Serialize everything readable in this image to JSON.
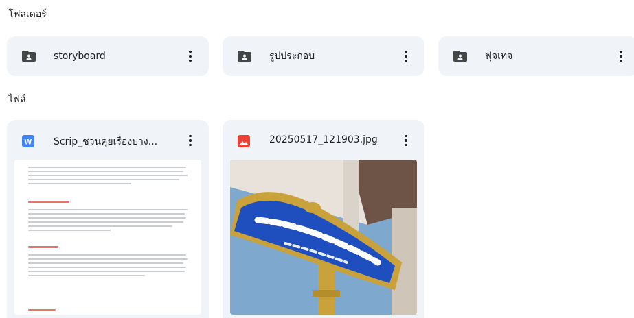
{
  "sections": {
    "folders_title": "โฟลเดอร์",
    "files_title": "ไฟล์"
  },
  "folders": [
    {
      "name": "storyboard",
      "icon": "shared-folder-icon"
    },
    {
      "name": "รูปประกอบ",
      "icon": "shared-folder-icon"
    },
    {
      "name": "ฟุจเทจ",
      "icon": "shared-folder-icon"
    }
  ],
  "files": [
    {
      "name": "Scrip_ชวนคุยเรื่องบาง...",
      "type": "word-doc",
      "icon": "word-icon",
      "icon_color": "#4285f4"
    },
    {
      "name": "20250517_121903.jpg",
      "type": "image",
      "icon": "image-icon",
      "icon_color": "#ea4335"
    }
  ],
  "colors": {
    "card_bg": "#f0f4f9",
    "text": "#1f1f1f",
    "folder_icon": "#444746"
  }
}
